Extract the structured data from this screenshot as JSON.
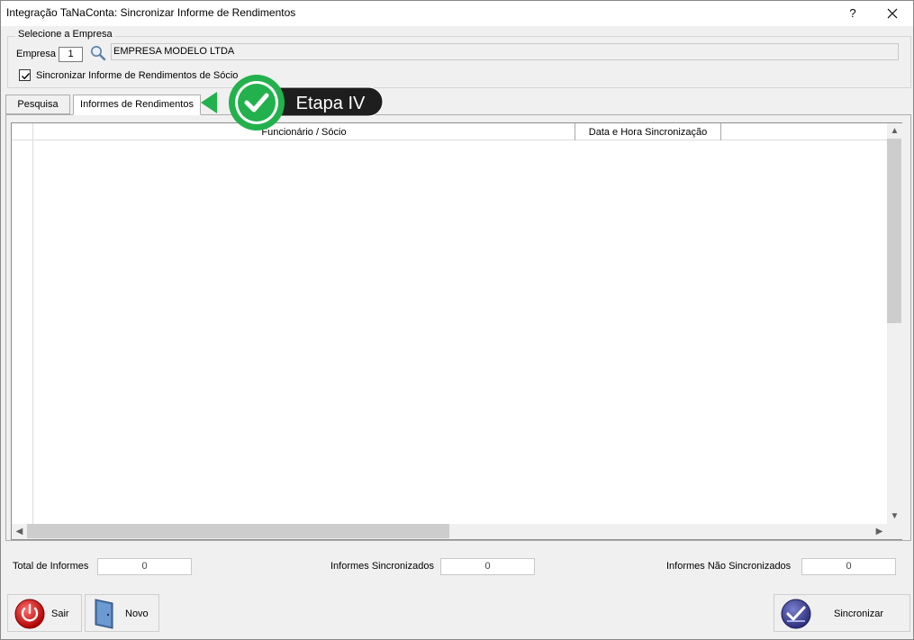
{
  "window": {
    "title": "Integração TaNaConta: Sincronizar Informe de Rendimentos",
    "help_label": "?",
    "close_label": "✕"
  },
  "empresa_group": {
    "legend": "Selecione a Empresa",
    "empresa_label": "Empresa",
    "empresa_code": "1",
    "empresa_name": "EMPRESA MODELO LTDA",
    "sync_socio_label": "Sincronizar Informe de Rendimentos de Sócio",
    "sync_socio_checked": true
  },
  "tabs": [
    {
      "label": "Pesquisa",
      "active": false
    },
    {
      "label": "Informes de Rendimentos",
      "active": true
    }
  ],
  "callout": {
    "label": "Etapa IV",
    "color": "#22b14c"
  },
  "grid": {
    "columns": [
      "Funcionário / Sócio",
      "Data e Hora Sincronização"
    ],
    "rows": []
  },
  "totals": {
    "total_label": "Total de Informes",
    "total_value": "0",
    "sincronizados_label": "Informes Sincronizados",
    "sincronizados_value": "0",
    "nao_sincronizados_label": "Informes Não Sincronizados",
    "nao_sincronizados_value": "0"
  },
  "buttons": {
    "sair_label": "Sair",
    "novo_label": "Novo",
    "sincronizar_label": "Sincronizar"
  },
  "icons": {
    "search": "search-icon",
    "power": "power-icon",
    "door": "door-icon",
    "sync": "sync-check-icon",
    "checkmark": "checkmark-icon"
  }
}
